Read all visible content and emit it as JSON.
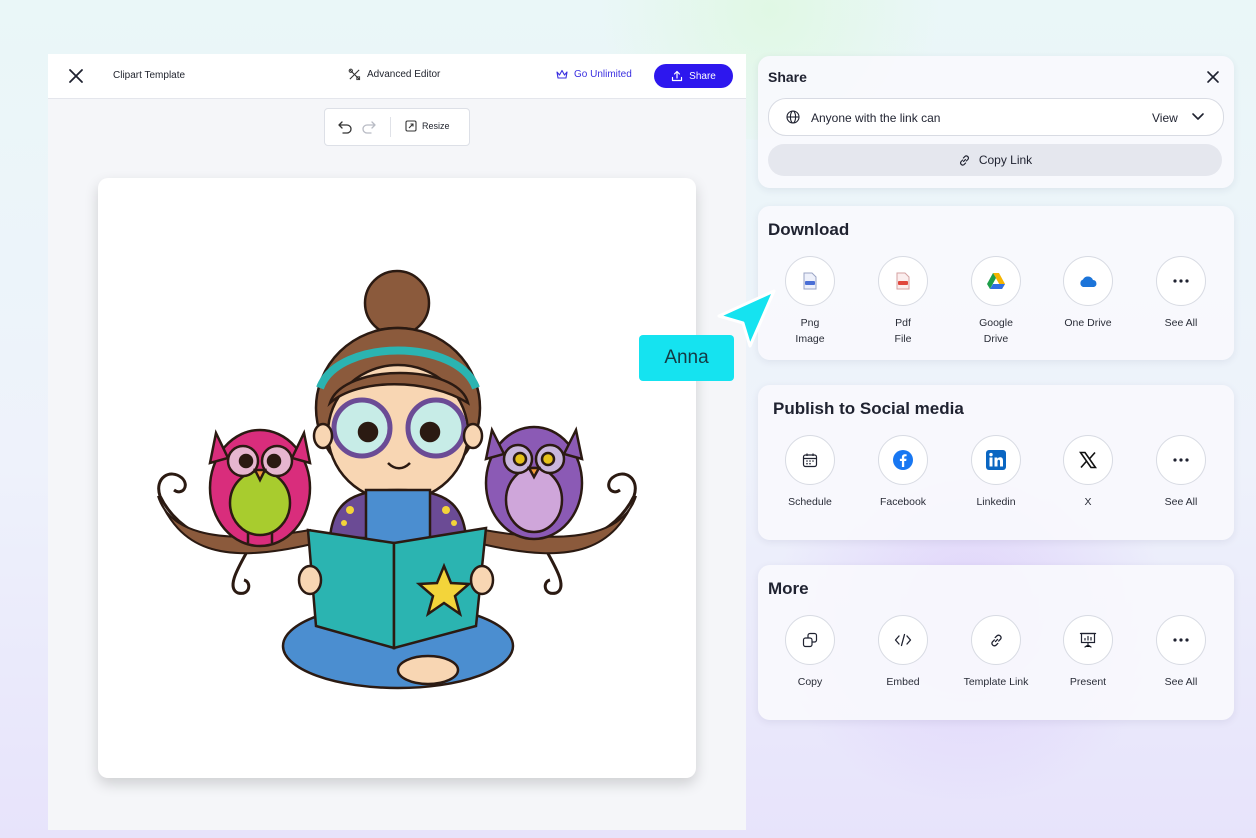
{
  "editor": {
    "title": "Clipart Template",
    "advanced_editor": "Advanced Editor",
    "go_unlimited": "Go Unlimited",
    "share": "Share",
    "resize": "Resize",
    "canvas_image": "girl-reading-with-owls-clipart"
  },
  "share_panel": {
    "title": "Share",
    "permission_text": "Anyone with the link can",
    "permission_value": "View",
    "copy_link": "Copy Link"
  },
  "download": {
    "title": "Download",
    "items": [
      {
        "label": "Png\nImage",
        "icon": "png-file-icon"
      },
      {
        "label": "Pdf\nFile",
        "icon": "pdf-file-icon"
      },
      {
        "label": "Google\nDrive",
        "icon": "google-drive-icon"
      },
      {
        "label": "One Drive",
        "icon": "onedrive-icon"
      },
      {
        "label": "See All",
        "icon": "more-icon"
      }
    ]
  },
  "social": {
    "title": "Publish to Social media",
    "items": [
      {
        "label": "Schedule",
        "icon": "calendar-icon"
      },
      {
        "label": "Facebook",
        "icon": "facebook-icon"
      },
      {
        "label": "Linkedin",
        "icon": "linkedin-icon"
      },
      {
        "label": "X",
        "icon": "x-icon"
      },
      {
        "label": "See All",
        "icon": "more-icon"
      }
    ]
  },
  "more": {
    "title": "More",
    "items": [
      {
        "label": "Copy",
        "icon": "copy-icon"
      },
      {
        "label": "Embed",
        "icon": "embed-code-icon"
      },
      {
        "label": "Template Link",
        "icon": "link-icon"
      },
      {
        "label": "Present",
        "icon": "present-icon"
      },
      {
        "label": "See All",
        "icon": "more-icon"
      }
    ]
  },
  "collaborator": {
    "name": "Anna"
  },
  "colors": {
    "accent": "#2d17ee",
    "cursor": "#15e3f0"
  }
}
